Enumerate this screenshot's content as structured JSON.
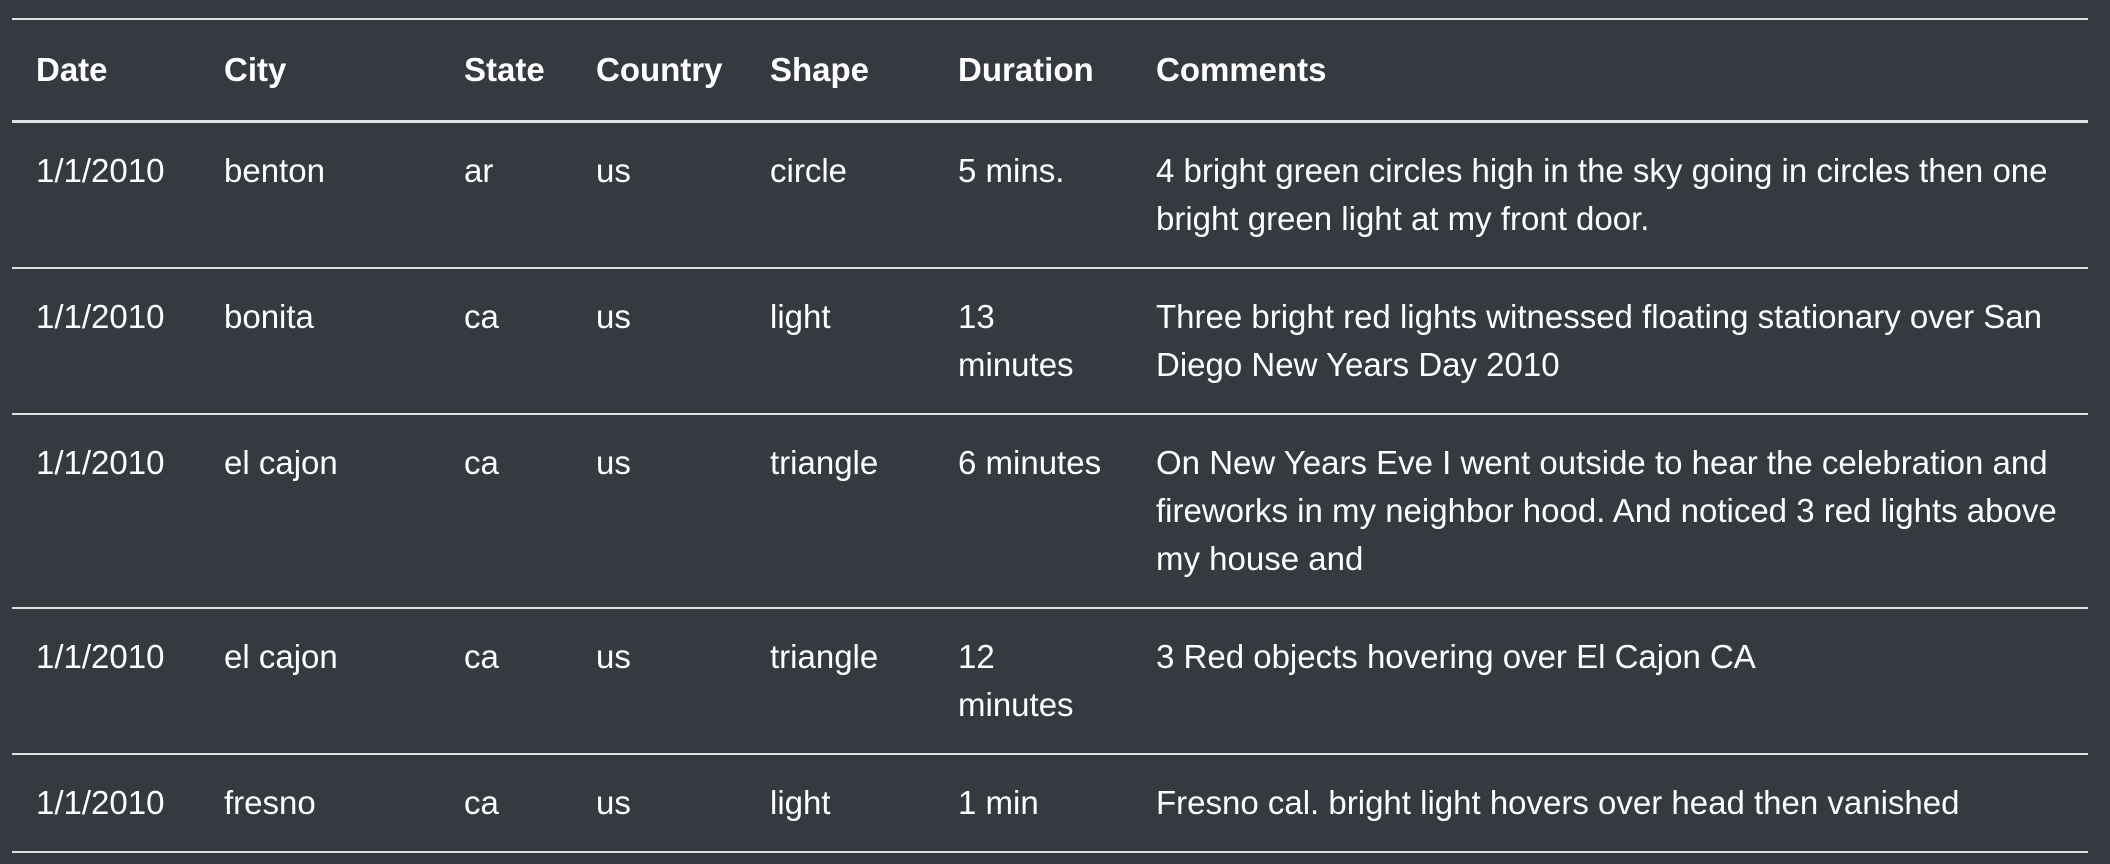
{
  "table": {
    "columns": [
      "Date",
      "City",
      "State",
      "Country",
      "Shape",
      "Duration",
      "Comments"
    ],
    "rows": [
      {
        "date": "1/1/2010",
        "city": "benton",
        "state": "ar",
        "country": "us",
        "shape": "circle",
        "duration": "5 mins.",
        "comments": "4 bright green circles high in the sky going in circles then one bright green light at my front door."
      },
      {
        "date": "1/1/2010",
        "city": "bonita",
        "state": "ca",
        "country": "us",
        "shape": "light",
        "duration": "13 minutes",
        "comments": "Three bright red lights witnessed floating stationary over San Diego New Years Day 2010"
      },
      {
        "date": "1/1/2010",
        "city": "el cajon",
        "state": "ca",
        "country": "us",
        "shape": "triangle",
        "duration": "6 minutes",
        "comments": "On New Years Eve I went outside to hear the celebration and fireworks in my neighbor hood. And noticed 3 red lights above my house and"
      },
      {
        "date": "1/1/2010",
        "city": "el cajon",
        "state": "ca",
        "country": "us",
        "shape": "triangle",
        "duration": "12 minutes",
        "comments": "3 Red objects hovering over El Cajon CA"
      },
      {
        "date": "1/1/2010",
        "city": "fresno",
        "state": "ca",
        "country": "us",
        "shape": "light",
        "duration": "1 min",
        "comments": "Fresno cal. bright light hovers over head then vanished"
      }
    ]
  }
}
